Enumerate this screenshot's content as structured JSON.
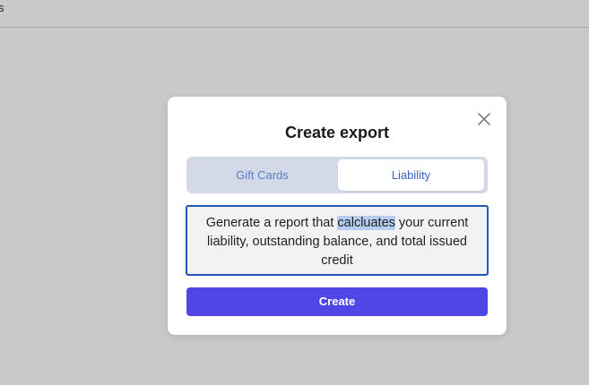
{
  "topbar": {
    "text": "s"
  },
  "modal": {
    "title": "Create export",
    "tabs": [
      {
        "label": "Gift Cards",
        "selected": false
      },
      {
        "label": "Liability",
        "selected": true
      }
    ],
    "description": {
      "before": "Generate a report that ",
      "highlighted": "calcluates",
      "after": " your current liability, outstanding balance, and total issued credit"
    },
    "create_label": "Create",
    "close_icon": "close-icon"
  },
  "colors": {
    "backdrop": "#c9c9c9",
    "accent": "#4f46e5",
    "tab_text": "#3b5fc2",
    "focus_border": "#2457b8",
    "selection": "#b5cdf0"
  }
}
